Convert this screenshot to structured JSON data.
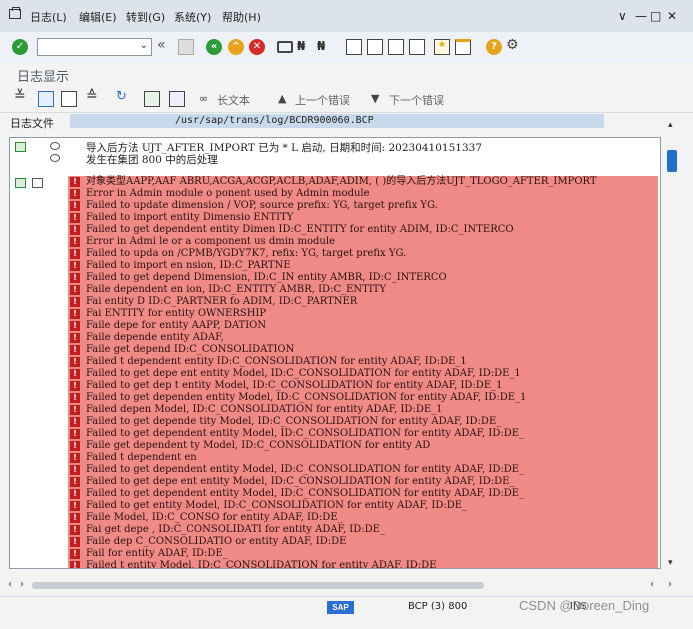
{
  "menu": {
    "items": [
      "日志(L)",
      "编辑(E)",
      "转到(G)",
      "系统(Y)",
      "帮助(H)"
    ],
    "window_controls": [
      "∨",
      "—",
      "□",
      "✕"
    ]
  },
  "toolbar": {
    "command_field_value": "",
    "icons": [
      "check-icon",
      "back-icon",
      "save-icon",
      "exit-icon",
      "cancel-icon",
      "print-icon",
      "find-icon",
      "find-next-icon",
      "first-page-icon",
      "prev-page-icon",
      "next-page-icon",
      "last-page-icon",
      "bookmark-icon",
      "layout-icon",
      "help-icon",
      "settings-icon"
    ]
  },
  "title": "日志显示",
  "app_toolbar": {
    "long_text": "长文本",
    "prev_error": "上一个错误",
    "next_error": "下一个错误"
  },
  "log_file": {
    "label": "日志文件",
    "path": "/usr/sap/trans/log/BCDR900060.BCP"
  },
  "header": {
    "line1": "导入后方法 UJT_AFTER_IMPORT 已为 * L 启动, 日期和时间: 20230410151337",
    "line2": "发生在集团 800 中的后处理"
  },
  "rows": [
    "对象类型AAPP,AAF          ABRU,ACGA,ACGP,ACLB,ADAF,ADIM, ( )的导入后方法UJT_TLOGO_AFTER_IMPORT",
    "Error in Admin module o    ponent used by Admin module",
    "Failed to update dimension /      VOP, source prefix: YG, target prefix YG.",
    "Failed to import entity Dimensio   ENTITY",
    "Failed to get dependent entity Dimen    ID:C_ENTITY for entity ADIM, ID:C_INTERCO",
    "Error in Admi      le or a component us    dmin module",
    "Failed to upda        on /CPMB/YGDY7K7,      refix: YG, target prefix YG.",
    "Failed to import en         nsion, ID:C_PARTNE",
    "Failed to get depend        Dimension, ID:C_IN         entity AMBR, ID:C_INTERCO",
    "Faile        dependent en        ion, ID:C_ENTITY         AMBR, ID:C_ENTITY",
    "Fai              entity D         ID:C_PARTNER fo         ADIM, ID:C_PARTNER",
    "Fai                                   ENTITY for entity        OWNERSHIP",
    "Faile        depe                             for entity AAPP,         DATION",
    "Faile         depende                                  entity ADAF,",
    "Faile     get depend              ID:C_CONSOLIDATION",
    "Failed t     dependent entity     ID:C_CONSOLIDATION for entity ADAF, ID:DE_1",
    "Failed to get depe    ent entity Model, ID:C_CONSOLIDATION for entity ADAF, ID:DE_1",
    "Failed to get dep     t entity Model, ID:C_CONSOLIDATION for entity ADAF, ID:DE_1",
    "Failed to get dependen   entity Model, ID:C_CONSOLIDATION for entity ADAF, ID:DE_1",
    "Failed      depen           Model, ID:C_CONSOLIDATION for entity ADAF, ID:DE_1",
    "Failed to get depende      tity Model, ID:C_CONSOLIDATION for entity ADAF, ID:DE_",
    "Failed to get dependent entity Model, ID:C_CONSOLIDATION for entity ADAF, ID:DE_",
    "Faile     get dependent     ty Model, ID:C_CONSOLIDATION for entity AD",
    "Failed t     dependent en",
    "Failed to get dependent entity Model, ID:C_CONSOLIDATION for entity ADAF, ID:DE_",
    "Failed to get depe    ent entity Model, ID:C_CONSOLIDATION for entity ADAF, ID:DE_",
    "Failed to get dependent entity Model, ID:C_CONSOLIDATION for entity ADAF, ID:DE_",
    "Failed to get         entity Model, ID:C_CONSOLIDATION for entity ADAF, ID:DE_",
    "Faile                    Model, ID:C_CONSO              for entity ADAF, ID:DE_",
    "Fai   get depe              , ID:C_CONSOLIDATI    for entity ADAF, ID:DE_",
    "Faile       dep                       C_CONSOLIDATIO    or entity ADAF, ID:DE",
    "Fail                                               for entity ADAF, ID:DE_",
    "Failed t               entity Model, ID:C_CONSOLIDATION for entity ADAF, ID:DE_",
    "Failed to get          ity Model, ID:C_CONSOLIDATION for entity ADAF, ID:DR"
  ],
  "status": {
    "system": "BCP (3) 800",
    "mode": "INS"
  },
  "watermark": "CSDN @Doreen_Ding"
}
